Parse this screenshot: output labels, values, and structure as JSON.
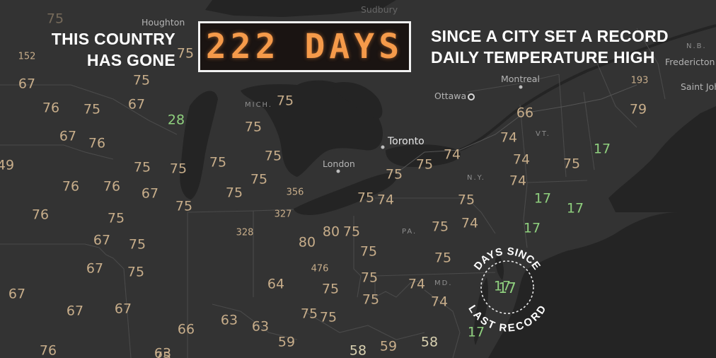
{
  "headline": {
    "left_line1": "THIS COUNTRY",
    "left_line2": "HAS GONE",
    "counter": "222 DAYS",
    "right_line1": "SINCE A CITY SET A RECORD",
    "right_line2": "DAILY TEMPERATURE HIGH"
  },
  "badge": {
    "top_text": "DAYS SINCE",
    "bottom_text": "LAST RECORD",
    "value": "17"
  },
  "colors": {
    "background": "#2c2c2c",
    "land": "#333333",
    "water": "#242424",
    "border": "#4a4a4a",
    "value_default": "#c7ad8a",
    "value_recent": "#8fd07e",
    "value_pale": "#d8d0b0",
    "counter_digits": "#f59a4a"
  },
  "cities": [
    {
      "name": "Houghton",
      "dot": false,
      "big": false
    },
    {
      "name": "Montreal",
      "dot": true,
      "big": false
    },
    {
      "name": "Ottawa",
      "dot": "ring",
      "big": false
    },
    {
      "name": "Toronto",
      "dot": true,
      "big": true
    },
    {
      "name": "London",
      "dot": true,
      "big": false
    },
    {
      "name": "Fredericton",
      "dot": false,
      "big": false
    },
    {
      "name": "Saint Joh",
      "dot": false,
      "big": false
    },
    {
      "name": "N.B.",
      "dot": false,
      "big": false,
      "state": true
    },
    {
      "name": "MICH.",
      "dot": false,
      "big": false,
      "state": true
    },
    {
      "name": "VT.",
      "dot": false,
      "big": false,
      "state": true
    },
    {
      "name": "N.Y.",
      "dot": false,
      "big": false,
      "state": true
    },
    {
      "name": "PA.",
      "dot": false,
      "big": false,
      "state": true
    },
    {
      "name": "MD.",
      "dot": false,
      "big": false,
      "state": true
    },
    {
      "name": "Sudbury",
      "dot": false,
      "big": false,
      "faint": true
    }
  ],
  "values": [
    {
      "v": "75",
      "c": "value_default",
      "faint": true
    },
    {
      "v": "75",
      "c": "value_default"
    },
    {
      "v": "152",
      "c": "value_default",
      "small": true
    },
    {
      "v": "67",
      "c": "value_default"
    },
    {
      "v": "75",
      "c": "value_default"
    },
    {
      "v": "76",
      "c": "value_default"
    },
    {
      "v": "75",
      "c": "value_default"
    },
    {
      "v": "67",
      "c": "value_default"
    },
    {
      "v": "28",
      "c": "value_recent"
    },
    {
      "v": "67",
      "c": "value_default"
    },
    {
      "v": "76",
      "c": "value_default"
    },
    {
      "v": "49",
      "c": "value_default"
    },
    {
      "v": "76",
      "c": "value_default"
    },
    {
      "v": "76",
      "c": "value_default"
    },
    {
      "v": "67",
      "c": "value_default"
    },
    {
      "v": "75",
      "c": "value_default"
    },
    {
      "v": "75",
      "c": "value_default"
    },
    {
      "v": "75",
      "c": "value_default"
    },
    {
      "v": "76",
      "c": "value_default"
    },
    {
      "v": "75",
      "c": "value_default"
    },
    {
      "v": "67",
      "c": "value_default"
    },
    {
      "v": "75",
      "c": "value_default"
    },
    {
      "v": "67",
      "c": "value_default"
    },
    {
      "v": "75",
      "c": "value_default"
    },
    {
      "v": "67",
      "c": "value_default"
    },
    {
      "v": "67",
      "c": "value_default"
    },
    {
      "v": "67",
      "c": "value_default"
    },
    {
      "v": "76",
      "c": "value_default"
    },
    {
      "v": "75",
      "c": "value_default"
    },
    {
      "v": "75",
      "c": "value_default"
    },
    {
      "v": "75",
      "c": "value_default"
    },
    {
      "v": "75",
      "c": "value_default"
    },
    {
      "v": "75",
      "c": "value_default"
    },
    {
      "v": "75",
      "c": "value_default"
    },
    {
      "v": "75",
      "c": "value_default"
    },
    {
      "v": "356",
      "c": "value_default",
      "small": true
    },
    {
      "v": "327",
      "c": "value_default",
      "small": true
    },
    {
      "v": "328",
      "c": "value_default",
      "small": true
    },
    {
      "v": "80",
      "c": "value_default"
    },
    {
      "v": "80",
      "c": "value_default"
    },
    {
      "v": "75",
      "c": "value_default"
    },
    {
      "v": "476",
      "c": "value_default",
      "small": true
    },
    {
      "v": "64",
      "c": "value_default"
    },
    {
      "v": "66",
      "c": "value_default"
    },
    {
      "v": "63",
      "c": "value_default"
    },
    {
      "v": "63",
      "c": "value_default"
    },
    {
      "v": "63",
      "c": "value_default"
    },
    {
      "v": "59",
      "c": "value_default"
    },
    {
      "v": "58",
      "c": "value_pale"
    },
    {
      "v": "59",
      "c": "value_default"
    },
    {
      "v": "58",
      "c": "value_pale"
    },
    {
      "v": "75",
      "c": "value_default"
    },
    {
      "v": "75",
      "c": "value_default"
    },
    {
      "v": "75",
      "c": "value_default"
    },
    {
      "v": "75",
      "c": "value_default"
    },
    {
      "v": "75",
      "c": "value_default"
    },
    {
      "v": "75",
      "c": "value_default"
    },
    {
      "v": "75",
      "c": "value_default"
    },
    {
      "v": "75",
      "c": "value_default"
    },
    {
      "v": "75",
      "c": "value_default"
    },
    {
      "v": "74",
      "c": "value_default"
    },
    {
      "v": "75",
      "c": "value_default"
    },
    {
      "v": "75",
      "c": "value_default"
    },
    {
      "v": "74",
      "c": "value_default"
    },
    {
      "v": "75",
      "c": "value_default"
    },
    {
      "v": "74",
      "c": "value_default"
    },
    {
      "v": "74",
      "c": "value_default"
    },
    {
      "v": "66",
      "c": "value_default"
    },
    {
      "v": "74",
      "c": "value_default"
    },
    {
      "v": "74",
      "c": "value_default"
    },
    {
      "v": "74",
      "c": "value_default"
    },
    {
      "v": "74",
      "c": "value_default"
    },
    {
      "v": "75",
      "c": "value_default"
    },
    {
      "v": "17",
      "c": "value_recent"
    },
    {
      "v": "17",
      "c": "value_recent"
    },
    {
      "v": "17",
      "c": "value_recent"
    },
    {
      "v": "17",
      "c": "value_recent"
    },
    {
      "v": "17",
      "c": "value_recent"
    },
    {
      "v": "17",
      "c": "value_recent"
    },
    {
      "v": "193",
      "c": "value_default",
      "small": true
    },
    {
      "v": "79",
      "c": "value_default"
    }
  ]
}
